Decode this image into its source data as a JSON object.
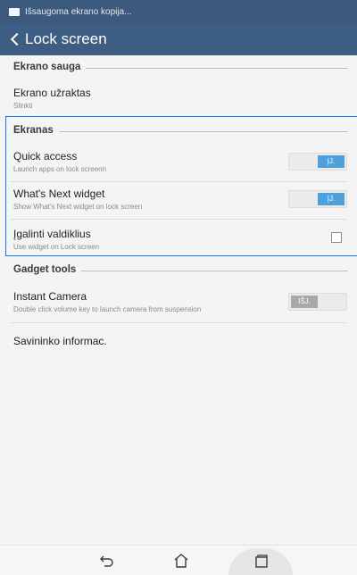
{
  "status_bar": {
    "text": "Išsaugoma ekrano kopija...",
    "icon": "screenshot-icon"
  },
  "action_bar": {
    "back_icon": "chevron-left-icon",
    "title": "Lock screen"
  },
  "sections": {
    "ekrano_sauga": {
      "label": "Ekrano sauga"
    },
    "ekranas": {
      "label": "Ekranas"
    },
    "gadget_tools": {
      "label": "Gadget tools"
    }
  },
  "rows": {
    "screen_lock": {
      "title": "Ekrano užraktas",
      "subtitle": "Slinkti"
    },
    "quick_access": {
      "title": "Quick access",
      "subtitle": "Launch apps on lock screenn",
      "toggle_label": "ĮJ.",
      "state": "on"
    },
    "whats_next": {
      "title": "What's Next widget",
      "subtitle": "Show What's Next widget on lock screen",
      "toggle_label": "ĮJ.",
      "state": "on"
    },
    "enable_widgets": {
      "title": "Įgalinti valdiklius",
      "subtitle": "Use widget on Lock screen",
      "checked": false
    },
    "instant_camera": {
      "title": "Instant Camera",
      "subtitle": "Double click volume key to launch camera from suspension",
      "toggle_label": "IŠJ.",
      "state": "off"
    },
    "owner_info": {
      "title": "Savininko informac."
    }
  },
  "nav": {
    "back_icon": "back-icon",
    "home_icon": "home-icon",
    "recents_icon": "recents-icon"
  },
  "colors": {
    "status_bar": "#3c5a7e",
    "action_bar": "#3e5d82",
    "accent": "#3e6fb0",
    "toggle_on": "#4ea0dc",
    "toggle_off": "#a8a8a8",
    "background": "#f4f4f4"
  }
}
